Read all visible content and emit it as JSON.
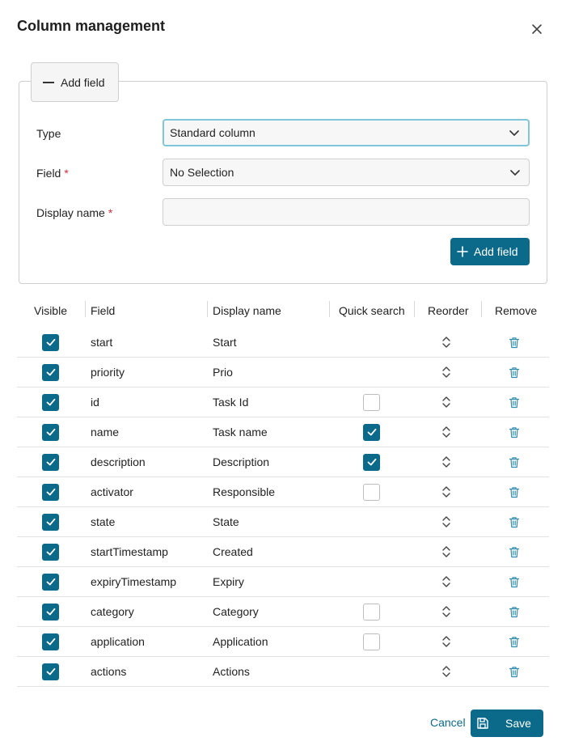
{
  "dialog": {
    "title": "Column management",
    "close_icon": "close-icon"
  },
  "add_field_section": {
    "toggle_label": "Add field",
    "type_label": "Type",
    "type_value": "Standard column",
    "field_label": "Field",
    "field_value": "No Selection",
    "display_name_label": "Display name",
    "display_name_value": "",
    "required_mark": "*",
    "add_button_label": "Add field"
  },
  "table": {
    "headers": {
      "visible": "Visible",
      "field": "Field",
      "display_name": "Display name",
      "quick_search": "Quick search",
      "reorder": "Reorder",
      "remove": "Remove"
    },
    "rows": [
      {
        "field": "start",
        "display_name": "Start",
        "visible": true,
        "quick_search": null
      },
      {
        "field": "priority",
        "display_name": "Prio",
        "visible": true,
        "quick_search": null
      },
      {
        "field": "id",
        "display_name": "Task Id",
        "visible": true,
        "quick_search": false
      },
      {
        "field": "name",
        "display_name": "Task name",
        "visible": true,
        "quick_search": true
      },
      {
        "field": "description",
        "display_name": "Description",
        "visible": true,
        "quick_search": true
      },
      {
        "field": "activator",
        "display_name": "Responsible",
        "visible": true,
        "quick_search": false
      },
      {
        "field": "state",
        "display_name": "State",
        "visible": true,
        "quick_search": null
      },
      {
        "field": "startTimestamp",
        "display_name": "Created",
        "visible": true,
        "quick_search": null
      },
      {
        "field": "expiryTimestamp",
        "display_name": "Expiry",
        "visible": true,
        "quick_search": null
      },
      {
        "field": "category",
        "display_name": "Category",
        "visible": true,
        "quick_search": false
      },
      {
        "field": "application",
        "display_name": "Application",
        "visible": true,
        "quick_search": false
      },
      {
        "field": "actions",
        "display_name": "Actions",
        "visible": true,
        "quick_search": null
      }
    ]
  },
  "footer": {
    "cancel_label": "Cancel",
    "save_label": "Save"
  },
  "colors": {
    "accent": "#0b6a8a",
    "focus_border": "#7fc6d9",
    "required": "#d92b3a"
  }
}
